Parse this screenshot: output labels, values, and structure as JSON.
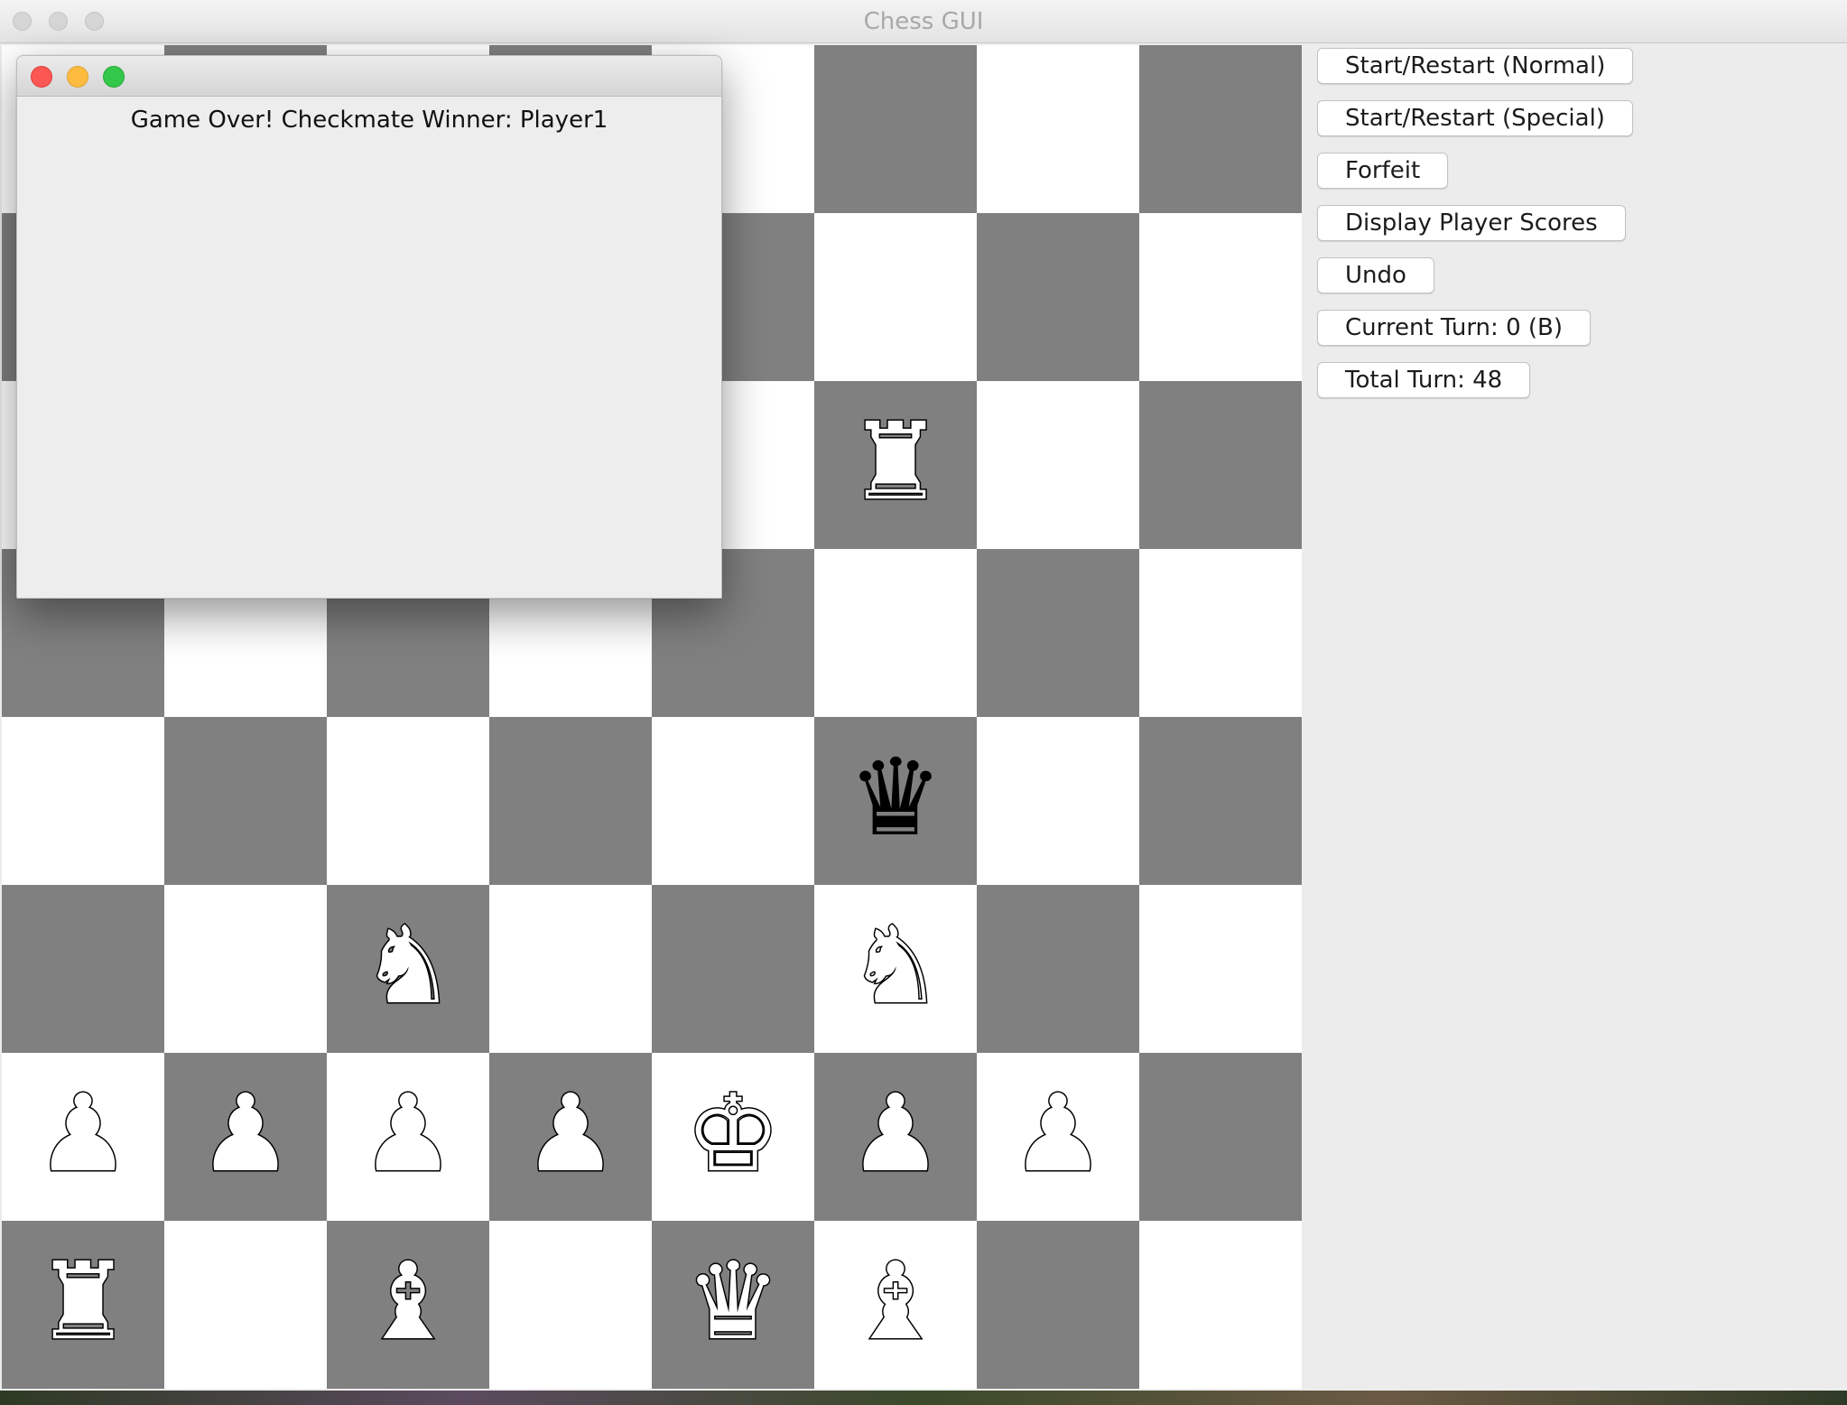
{
  "window": {
    "title": "Chess GUI"
  },
  "controls": {
    "start_normal": "Start/Restart (Normal)",
    "start_special": "Start/Restart (Special)",
    "forfeit": "Forfeit",
    "display_scores": "Display Player Scores",
    "undo": "Undo",
    "current_turn": "Current Turn: 0 (B)",
    "total_turn": "Total Turn: 48"
  },
  "dialog": {
    "message": "Game Over! Checkmate Winner: Player1"
  },
  "board": {
    "light_color": "#ffffff",
    "dark_color": "#808080",
    "ranks": [
      [
        "",
        "",
        "",
        "",
        "",
        "",
        "",
        ""
      ],
      [
        "",
        "",
        "",
        "",
        "",
        "",
        "",
        ""
      ],
      [
        "",
        "",
        "",
        "",
        "",
        "R",
        "",
        ""
      ],
      [
        "",
        "",
        "",
        "",
        "",
        "",
        "",
        ""
      ],
      [
        "",
        "",
        "",
        "",
        "",
        "q",
        "",
        ""
      ],
      [
        "",
        "",
        "N",
        "",
        "",
        "N",
        "",
        ""
      ],
      [
        "P",
        "P",
        "P",
        "P",
        "K",
        "P",
        "P",
        ""
      ],
      [
        "R",
        "",
        "B",
        "",
        "Q",
        "B",
        "",
        ""
      ]
    ]
  }
}
